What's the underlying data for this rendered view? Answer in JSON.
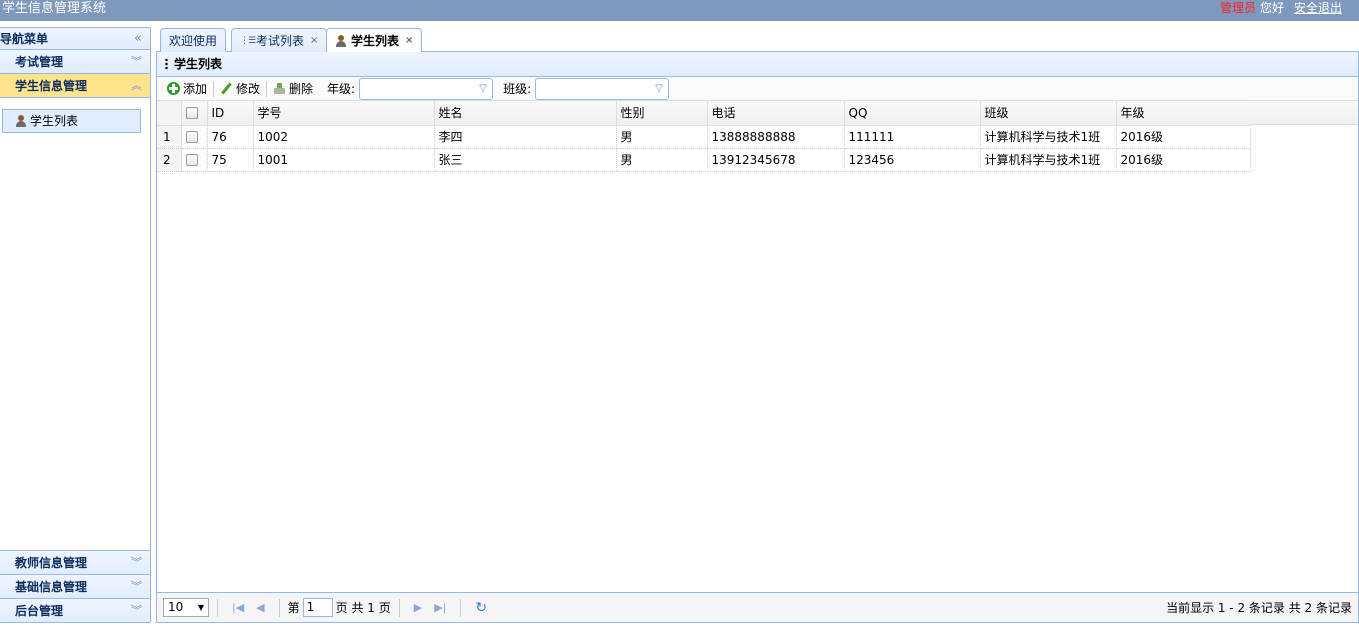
{
  "header": {
    "title": "学生信息管理系统",
    "admin": "管理员",
    "hello": "您好",
    "logout": "安全退出",
    "bg_color": "#7f99be"
  },
  "nav": {
    "title": "导航菜单",
    "collapse_icon": "double-chevron-left-icon",
    "sections": [
      {
        "label": "考试管理",
        "expanded": false
      },
      {
        "label": "学生信息管理",
        "expanded": true,
        "items": [
          {
            "label": "学生列表",
            "icon": "person-icon"
          }
        ]
      }
    ],
    "bottom_sections": [
      {
        "label": "教师信息管理"
      },
      {
        "label": "基础信息管理"
      },
      {
        "label": "后台管理"
      }
    ]
  },
  "tabs": [
    {
      "label": "欢迎使用",
      "closable": false,
      "selected": false
    },
    {
      "label": "考试列表",
      "closable": true,
      "selected": false,
      "icon": "list-icon"
    },
    {
      "label": "学生列表",
      "closable": true,
      "selected": true,
      "icon": "person-icon"
    }
  ],
  "panel": {
    "title": "学生列表"
  },
  "toolbar": {
    "add_label": "添加",
    "edit_label": "修改",
    "delete_label": "删除",
    "grade_label": "年级:",
    "class_label": "班级:",
    "grade_value": "",
    "class_value": ""
  },
  "grid": {
    "columns": [
      "ID",
      "学号",
      "姓名",
      "性别",
      "电话",
      "QQ",
      "班级",
      "年级"
    ],
    "rows": [
      {
        "rownum": "1",
        "id": "76",
        "sn": "1002",
        "name": "李四",
        "sex": "男",
        "phone": "13888888888",
        "qq": "111111",
        "clazz": "计算机科学与技术1班",
        "grade": "2016级"
      },
      {
        "rownum": "2",
        "id": "75",
        "sn": "1001",
        "name": "张三",
        "sex": "男",
        "phone": "13912345678",
        "qq": "123456",
        "clazz": "计算机科学与技术1班",
        "grade": "2016级"
      }
    ]
  },
  "pager": {
    "page_size": "10",
    "page_prefix": "第",
    "page_number": "1",
    "page_suffix": "页 共 1 页",
    "info": "当前显示 1 - 2 条记录 共 2 条记录"
  }
}
